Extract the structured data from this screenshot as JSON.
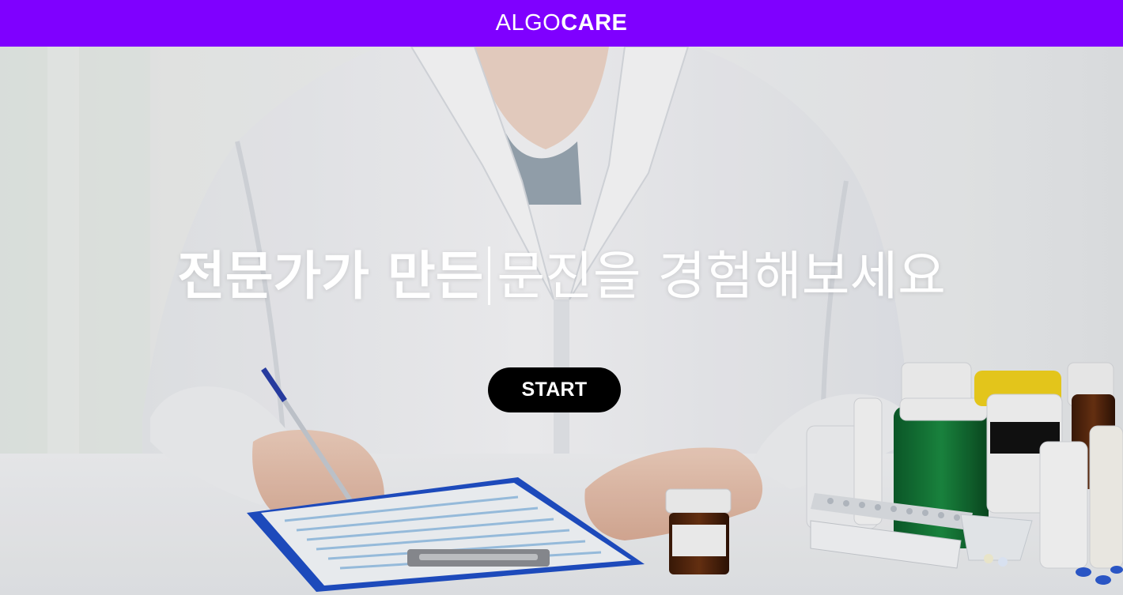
{
  "header": {
    "logo_light": "ALGO",
    "logo_bold": "CARE",
    "background_color": "#7f00ff"
  },
  "hero": {
    "headline_bold": "전문가가 만든",
    "headline_light": "문진을 경험해보세요",
    "start_label": "START",
    "image_description_icon": "doctor-with-medicines-image"
  }
}
